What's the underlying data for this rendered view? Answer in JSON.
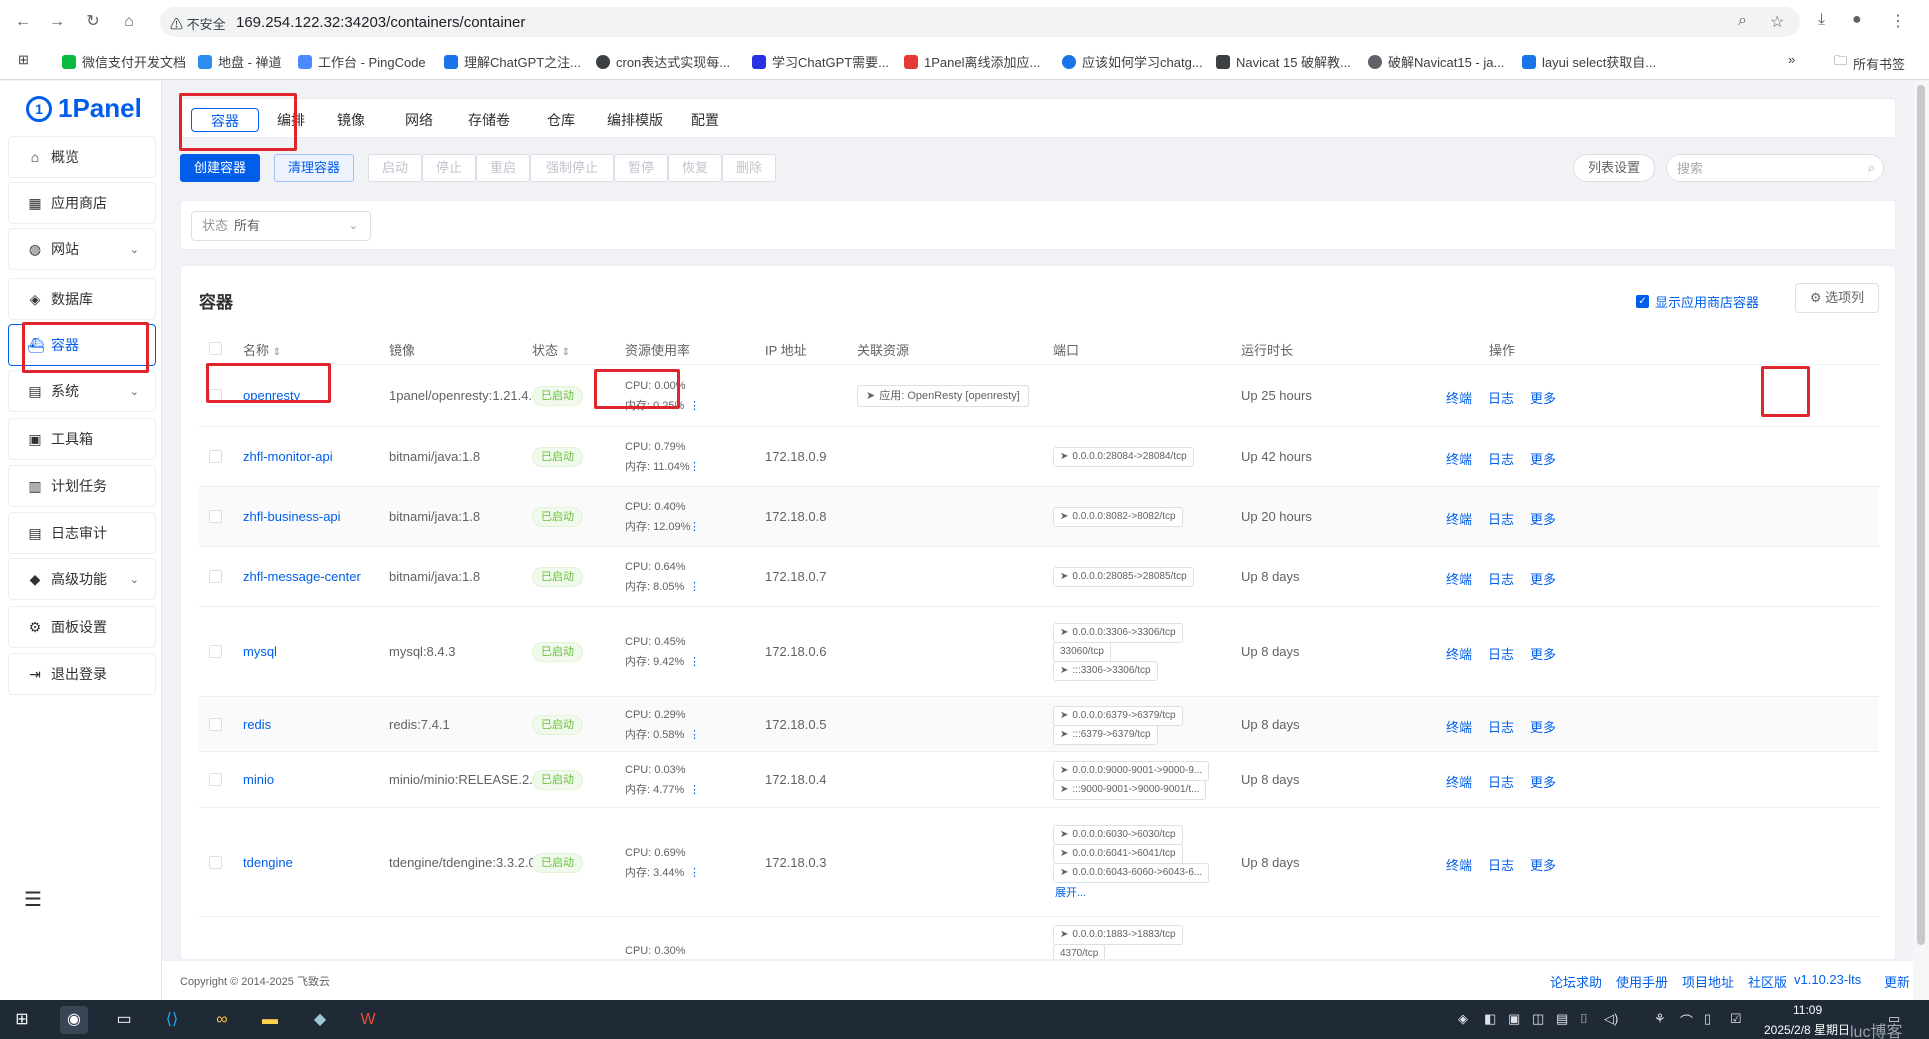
{
  "browser": {
    "security_label": "不安全",
    "url": "169.254.122.32:34203/containers/container",
    "bookmarks": [
      "微信支付开发文档",
      "地盘 - 禅道",
      "工作台 - PingCode",
      "理解ChatGPT之注...",
      "cron表达式实现每...",
      "学习ChatGPT需要...",
      "1Panel离线添加应...",
      "应该如何学习chatg...",
      "Navicat 15 破解教...",
      "破解Navicat15 - ja...",
      "layui select获取自..."
    ],
    "more_bookmarks": "»",
    "all_bookmarks": "所有书签"
  },
  "sidebar": {
    "logo": "1Panel",
    "items": [
      {
        "label": "概览",
        "icon": "home-icon",
        "has_arrow": false
      },
      {
        "label": "应用商店",
        "icon": "grid-icon",
        "has_arrow": false
      },
      {
        "label": "网站",
        "icon": "globe-icon",
        "has_arrow": true
      },
      {
        "label": "数据库",
        "icon": "layers-icon",
        "has_arrow": false
      },
      {
        "label": "容器",
        "icon": "docker-icon",
        "has_arrow": false,
        "active": true
      },
      {
        "label": "系统",
        "icon": "system-icon",
        "has_arrow": true
      },
      {
        "label": "工具箱",
        "icon": "toolbox-icon",
        "has_arrow": false
      },
      {
        "label": "计划任务",
        "icon": "calendar-icon",
        "has_arrow": false
      },
      {
        "label": "日志审计",
        "icon": "log-icon",
        "has_arrow": false
      },
      {
        "label": "高级功能",
        "icon": "diamond-icon",
        "has_arrow": true
      },
      {
        "label": "面板设置",
        "icon": "gear-icon",
        "has_arrow": false
      },
      {
        "label": "退出登录",
        "icon": "logout-icon",
        "has_arrow": false
      }
    ]
  },
  "tabs": [
    "容器",
    "编排",
    "镜像",
    "网络",
    "存储卷",
    "仓库",
    "编排模版",
    "配置"
  ],
  "toolbar": {
    "create": "创建容器",
    "prune": "清理容器",
    "start": "启动",
    "stop": "停止",
    "restart": "重启",
    "kill": "强制停止",
    "pause": "暂停",
    "resume": "恢复",
    "delete": "删除",
    "columns_setting": "列表设置",
    "search_placeholder": "搜索"
  },
  "filter": {
    "label": "状态",
    "value": "所有"
  },
  "panel": {
    "title": "容器",
    "show_store": "显示应用商店容器",
    "select_columns": "选项列"
  },
  "table": {
    "headers": {
      "name": "名称",
      "image": "镜像",
      "state": "状态",
      "resource": "资源使用率",
      "ip": "IP 地址",
      "related": "关联资源",
      "ports": "端口",
      "uptime": "运行时长",
      "actions": "操作"
    },
    "action_labels": {
      "terminal": "终端",
      "log": "日志",
      "more": "更多"
    },
    "expand_label": "展开...",
    "rows": [
      {
        "name": "openresty",
        "image": "1panel/openresty:1.21.4....",
        "state": "已启动",
        "cpu": "CPU: 0.00%",
        "mem": "内存: 0.25%",
        "ip": "",
        "related": "应用: OpenResty [openresty]",
        "ports": [],
        "uptime": "Up 25 hours"
      },
      {
        "name": "zhfl-monitor-api",
        "image": "bitnami/java:1.8",
        "state": "已启动",
        "cpu": "CPU: 0.79%",
        "mem": "内存: 11.04%",
        "ip": "172.18.0.9",
        "related": "",
        "ports": [
          "0.0.0.0:28084->28084/tcp"
        ],
        "uptime": "Up 42 hours"
      },
      {
        "name": "zhfl-business-api",
        "image": "bitnami/java:1.8",
        "state": "已启动",
        "cpu": "CPU: 0.40%",
        "mem": "内存: 12.09%",
        "ip": "172.18.0.8",
        "related": "",
        "ports": [
          "0.0.0.0:8082->8082/tcp"
        ],
        "uptime": "Up 20 hours"
      },
      {
        "name": "zhfl-message-center",
        "image": "bitnami/java:1.8",
        "state": "已启动",
        "cpu": "CPU: 0.64%",
        "mem": "内存: 8.05%",
        "ip": "172.18.0.7",
        "related": "",
        "ports": [
          "0.0.0.0:28085->28085/tcp"
        ],
        "uptime": "Up 8 days"
      },
      {
        "name": "mysql",
        "image": "mysql:8.4.3",
        "state": "已启动",
        "cpu": "CPU: 0.45%",
        "mem": "内存: 9.42%",
        "ip": "172.18.0.6",
        "related": "",
        "ports": [
          "0.0.0.0:3306->3306/tcp",
          "33060/tcp",
          ":::3306->3306/tcp"
        ],
        "uptime": "Up 8 days"
      },
      {
        "name": "redis",
        "image": "redis:7.4.1",
        "state": "已启动",
        "cpu": "CPU: 0.29%",
        "mem": "内存: 0.58%",
        "ip": "172.18.0.5",
        "related": "",
        "ports": [
          "0.0.0.0:6379->6379/tcp",
          ":::6379->6379/tcp"
        ],
        "uptime": "Up 8 days"
      },
      {
        "name": "minio",
        "image": "minio/minio:RELEASE.2....",
        "state": "已启动",
        "cpu": "CPU: 0.03%",
        "mem": "内存: 4.77%",
        "ip": "172.18.0.4",
        "related": "",
        "ports": [
          "0.0.0.0:9000-9001->9000-9...",
          ":::9000-9001->9000-9001/t..."
        ],
        "uptime": "Up 8 days"
      },
      {
        "name": "tdengine",
        "image": "tdengine/tdengine:3.3.2.0",
        "state": "已启动",
        "cpu": "CPU: 0.69%",
        "mem": "内存: 3.44%",
        "ip": "172.18.0.3",
        "related": "",
        "ports": [
          "0.0.0.0:6030->6030/tcp",
          "0.0.0.0:6041->6041/tcp",
          "0.0.0.0:6043-6060->6043-6..."
        ],
        "uptime": "Up 8 days"
      },
      {
        "name": "",
        "image": "",
        "state": "",
        "cpu": "CPU: 0.30%",
        "mem": "",
        "ip": "",
        "related": "",
        "ports": [
          "0.0.0.0:1883->1883/tcp",
          "4370/tcp"
        ],
        "uptime": ""
      }
    ]
  },
  "footer": {
    "copyright": "Copyright © 2014-2025 飞致云",
    "links": [
      "论坛求助",
      "使用手册",
      "项目地址",
      "社区版",
      "v1.10.23-lts",
      "更新"
    ]
  },
  "taskbar": {
    "time": "11:09",
    "date": "2025/2/8 星期日"
  },
  "watermark": "luc博客",
  "colors": {
    "primary": "#005eeb",
    "success": "#67c23a",
    "annotation": "#e0242c"
  }
}
